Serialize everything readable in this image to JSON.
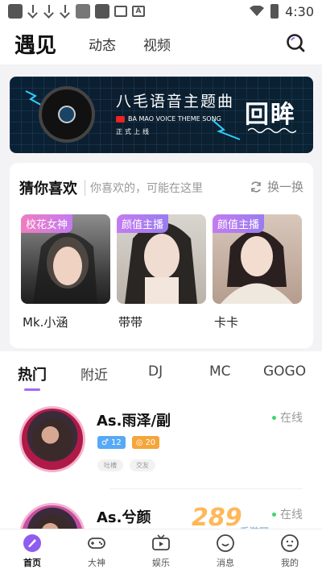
{
  "status_bar": {
    "time": "4:30",
    "icons": [
      "notification-icon",
      "download-icon",
      "download-icon",
      "download-icon",
      "app-icon",
      "app-icon",
      "mail-icon",
      "a-icon"
    ]
  },
  "top_nav": {
    "tabs": [
      "遇见",
      "动态",
      "视频"
    ],
    "active": "遇见"
  },
  "banner": {
    "title": "八毛语音主题曲",
    "subtitle": "BA MAO VOICE THEME SONG",
    "tag": "正式上线",
    "big_text": "回眸"
  },
  "guess": {
    "title": "猜你喜欢",
    "subtitle": "你喜欢的，可能在这里",
    "refresh_label": "换一换",
    "items": [
      {
        "tag": "校花女神",
        "name": "Mk.小涵"
      },
      {
        "tag": "颜值主播",
        "name": "带带"
      },
      {
        "tag": "颜值主播",
        "name": "卡卡"
      }
    ]
  },
  "feed_tabs": [
    "热门",
    "附近",
    "DJ",
    "MC",
    "GOGO"
  ],
  "users": [
    {
      "name": "As.雨泽/副",
      "status": "在线",
      "gender_count": "12",
      "level": "20",
      "tags": [
        "吐槽",
        "交友"
      ]
    },
    {
      "name": "As.兮颜",
      "status": "在线"
    }
  ],
  "bottom_tabs": [
    "首页",
    "大神",
    "娱乐",
    "消息",
    "我的"
  ],
  "watermark": {
    "text": "289",
    "sub": "手游网"
  },
  "colors": {
    "accent": "#a06cf0",
    "online": "#3fd56b",
    "tag_purple": "#b46cf3"
  }
}
